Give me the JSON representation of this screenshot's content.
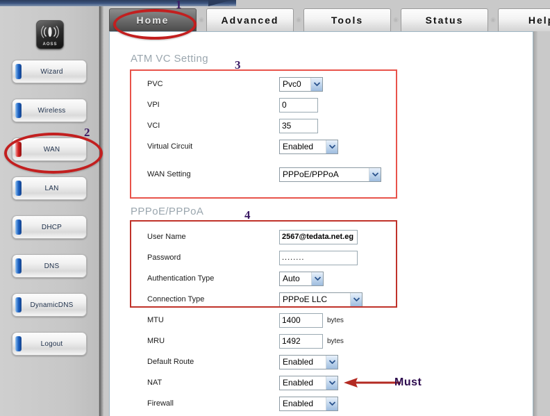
{
  "app": {
    "logo_label": "AOSS",
    "logo_icon": "wireless-antenna-icon"
  },
  "sidebar": {
    "items": [
      {
        "label": "Wizard",
        "active": false
      },
      {
        "label": "Wireless",
        "active": false
      },
      {
        "label": "WAN",
        "active": true
      },
      {
        "label": "LAN",
        "active": false
      },
      {
        "label": "DHCP",
        "active": false
      },
      {
        "label": "DNS",
        "active": false
      },
      {
        "label": "DynamicDNS",
        "active": false
      },
      {
        "label": "Logout",
        "active": false
      }
    ]
  },
  "tabs": [
    {
      "label": "Home",
      "active": true
    },
    {
      "label": "Advanced",
      "active": false
    },
    {
      "label": "Tools",
      "active": false
    },
    {
      "label": "Status",
      "active": false
    },
    {
      "label": "Help",
      "active": false
    }
  ],
  "sections": {
    "atm": {
      "title": "ATM VC Setting",
      "pvc": {
        "label": "PVC",
        "value": "Pvc0"
      },
      "vpi": {
        "label": "VPI",
        "value": "0"
      },
      "vci": {
        "label": "VCI",
        "value": "35"
      },
      "virtual_circuit": {
        "label": "Virtual Circuit",
        "value": "Enabled"
      },
      "wan_setting": {
        "label": "WAN Setting",
        "value": "PPPoE/PPPoA"
      }
    },
    "pppoe": {
      "title": "PPPoE/PPPoA",
      "user_name": {
        "label": "User Name",
        "value": "2567@tedata.net.eg"
      },
      "password": {
        "label": "Password",
        "value": "........"
      },
      "auth_type": {
        "label": "Authentication Type",
        "value": "Auto"
      },
      "connection_type": {
        "label": "Connection Type",
        "value": "PPPoE LLC"
      }
    },
    "misc": {
      "mtu": {
        "label": "MTU",
        "value": "1400",
        "unit": "bytes"
      },
      "mru": {
        "label": "MRU",
        "value": "1492",
        "unit": "bytes"
      },
      "default_route": {
        "label": "Default Route",
        "value": "Enabled"
      },
      "nat": {
        "label": "NAT",
        "value": "Enabled"
      },
      "firewall": {
        "label": "Firewall",
        "value": "Enabled"
      }
    }
  },
  "annotations": {
    "n1": "1",
    "n2": "2",
    "n3": "3",
    "n4": "4",
    "must": "Must"
  },
  "colors": {
    "annotation_red": "#c21f1f",
    "annotation_purple": "#3b1a64",
    "tab_active_bg": "#5c5c5c",
    "accent_blue": "#1d62c4",
    "accent_red": "#d42020"
  }
}
